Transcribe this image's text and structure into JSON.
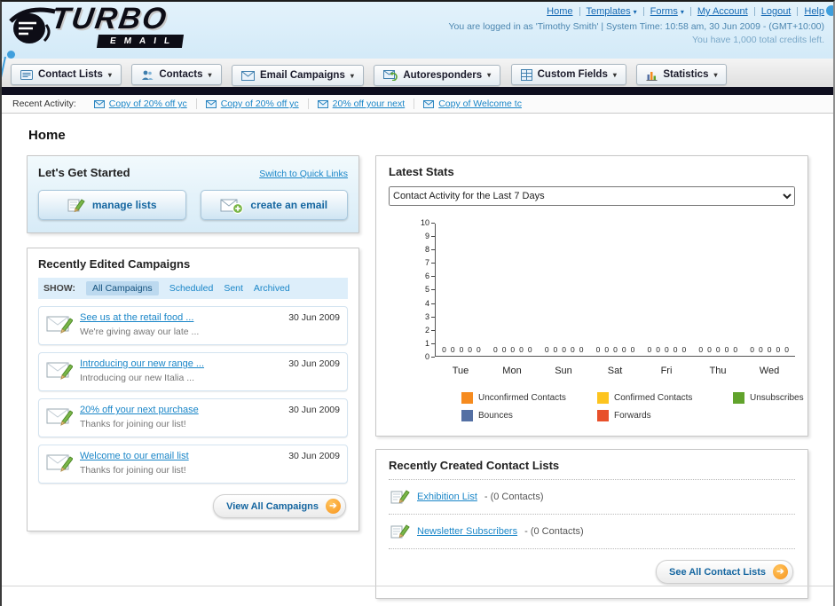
{
  "header": {
    "logo_line1": "TURBO",
    "logo_line2": "EMAIL",
    "links": [
      {
        "label": "Home"
      },
      {
        "label": "Templates"
      },
      {
        "label": "Forms"
      },
      {
        "label": "My Account"
      },
      {
        "label": "Logout"
      },
      {
        "label": "Help"
      }
    ],
    "login_info": "You are logged in as 'Timothy Smith' | System Time: 10:58 am, 30 Jun 2009 - (GMT+10:00)",
    "credits": "You have 1,000 total credits left."
  },
  "nav": {
    "items": [
      {
        "label": "Contact Lists"
      },
      {
        "label": "Contacts"
      },
      {
        "label": "Email Campaigns"
      },
      {
        "label": "Autoresponders"
      },
      {
        "label": "Custom Fields"
      },
      {
        "label": "Statistics"
      }
    ]
  },
  "activity": {
    "label": "Recent Activity:",
    "items": [
      {
        "label": "Copy of 20% off yc"
      },
      {
        "label": "Copy of 20% off yc"
      },
      {
        "label": "20% off your next"
      },
      {
        "label": "Copy of Welcome tc"
      }
    ]
  },
  "page_title": "Home",
  "get_started": {
    "title": "Let's Get Started",
    "switch_label": "Switch to Quick Links",
    "manage_button": "manage lists",
    "create_button": "create an email"
  },
  "campaigns": {
    "title": "Recently Edited Campaigns",
    "show_label": "SHOW:",
    "tabs": [
      {
        "label": "All Campaigns"
      },
      {
        "label": "Scheduled"
      },
      {
        "label": "Sent"
      },
      {
        "label": "Archived"
      }
    ],
    "active_tab": "All Campaigns",
    "items": [
      {
        "title": "See us at the retail food ...",
        "subtitle": "We're giving away our late ...",
        "date": "30 Jun 2009"
      },
      {
        "title": "Introducing our new range ...",
        "subtitle": "Introducing our new Italia ...",
        "date": "30 Jun 2009"
      },
      {
        "title": "20% off your next purchase",
        "subtitle": "Thanks for joining our list!",
        "date": "30 Jun 2009"
      },
      {
        "title": "Welcome to our email list",
        "subtitle": "Thanks for joining our list!",
        "date": "30 Jun 2009"
      }
    ],
    "view_all_label": "View All Campaigns"
  },
  "stats": {
    "title": "Latest Stats",
    "selected_option": "Contact Activity for the Last 7 Days"
  },
  "chart_data": {
    "type": "bar",
    "title": "Contact Activity for the Last 7 Days",
    "categories": [
      "Tue",
      "Mon",
      "Sun",
      "Sat",
      "Fri",
      "Thu",
      "Wed"
    ],
    "series": [
      {
        "name": "Unconfirmed Contacts",
        "color": "#f68b1f",
        "values": [
          0,
          0,
          0,
          0,
          0,
          0,
          0
        ]
      },
      {
        "name": "Confirmed Contacts",
        "color": "#fdc41f",
        "values": [
          0,
          0,
          0,
          0,
          0,
          0,
          0
        ]
      },
      {
        "name": "Unsubscribes",
        "color": "#61a32c",
        "values": [
          0,
          0,
          0,
          0,
          0,
          0,
          0
        ]
      },
      {
        "name": "Bounces",
        "color": "#5470a4",
        "values": [
          0,
          0,
          0,
          0,
          0,
          0,
          0
        ]
      },
      {
        "name": "Forwards",
        "color": "#e8502a",
        "values": [
          0,
          0,
          0,
          0,
          0,
          0,
          0
        ]
      }
    ],
    "ylim": [
      0,
      10
    ],
    "yticks": [
      10,
      9,
      8,
      7,
      6,
      5,
      4,
      3,
      2,
      1,
      0
    ],
    "grid": false,
    "legend_position": "bottom"
  },
  "contact_lists": {
    "title": "Recently Created Contact Lists",
    "items": [
      {
        "name": "Exhibition List",
        "detail": "- (0 Contacts)"
      },
      {
        "name": "Newsletter Subscribers",
        "detail": "- (0 Contacts)"
      }
    ],
    "see_all_label": "See All Contact Lists"
  }
}
